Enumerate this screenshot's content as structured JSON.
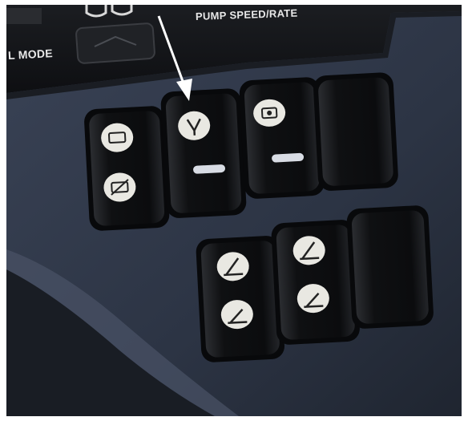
{
  "labels": {
    "pump_speed_rate": "PUMP SPEED/RATE",
    "control_mode_partial": "L MODE"
  },
  "switches": [
    {
      "id": "rocker-1",
      "top_icon": "camera-icon",
      "bottom_icon": "camera-off-icon",
      "indicator": "none"
    },
    {
      "id": "rocker-2",
      "top_icon": "hand-pump-icon",
      "bottom_icon": "none",
      "indicator": "indicator-bar"
    },
    {
      "id": "rocker-3",
      "top_icon": "spray-fan-icon",
      "bottom_icon": "none",
      "indicator": "indicator-bar"
    },
    {
      "id": "rocker-4",
      "top_icon": "none",
      "bottom_icon": "none",
      "indicator": "blank"
    },
    {
      "id": "rocker-5",
      "top_icon": "boom-raise-icon",
      "bottom_icon": "boom-lower-icon",
      "indicator": "none"
    },
    {
      "id": "rocker-6",
      "top_icon": "boom-raise-icon",
      "bottom_icon": "boom-lower-icon",
      "indicator": "none"
    },
    {
      "id": "rocker-7",
      "top_icon": "none",
      "bottom_icon": "none",
      "indicator": "blank"
    }
  ],
  "annotation": {
    "type": "arrow",
    "points_to": "rocker-2"
  },
  "colors": {
    "panel": "#2f3747",
    "upper_console": "#14161a",
    "rocker_body": "#0d0e10",
    "icon_badge": "#e9e8e2",
    "indicator": "#d8dce4"
  }
}
